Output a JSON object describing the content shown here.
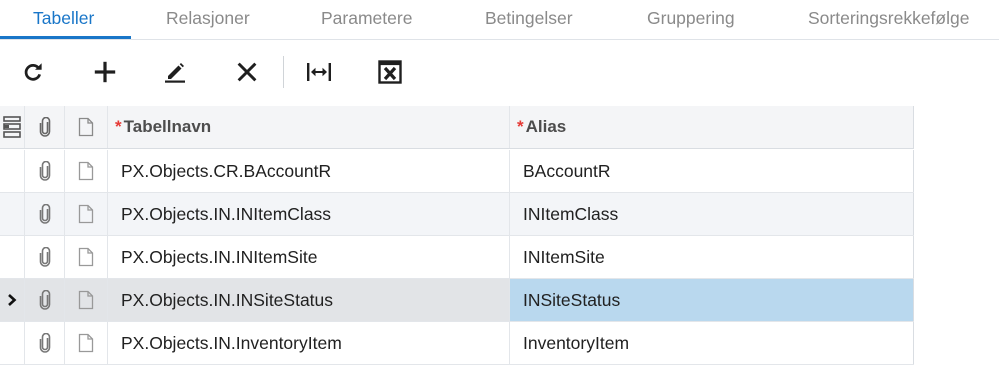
{
  "tabs": [
    {
      "label": "Tabeller",
      "active": true
    },
    {
      "label": "Relasjoner",
      "active": false
    },
    {
      "label": "Parametere",
      "active": false
    },
    {
      "label": "Betingelser",
      "active": false
    },
    {
      "label": "Gruppering",
      "active": false
    },
    {
      "label": "Sorteringsrekkefølge",
      "active": false
    }
  ],
  "toolbar": {
    "buttons": [
      {
        "icon": "refresh-icon"
      },
      {
        "icon": "plus-icon"
      },
      {
        "icon": "pencil-icon"
      },
      {
        "icon": "close-icon"
      },
      {
        "icon": "fit-columns-icon"
      },
      {
        "icon": "excel-export-icon"
      }
    ]
  },
  "grid": {
    "columns": {
      "name": {
        "required_mark": "*",
        "label": "Tabellnavn"
      },
      "alias": {
        "required_mark": "*",
        "label": "Alias"
      }
    },
    "rows": [
      {
        "name": "PX.Objects.CR.BAccountR",
        "alias": "BAccountR",
        "selected": false
      },
      {
        "name": "PX.Objects.IN.INItemClass",
        "alias": "INItemClass",
        "selected": false
      },
      {
        "name": "PX.Objects.IN.INItemSite",
        "alias": "INItemSite",
        "selected": false
      },
      {
        "name": "PX.Objects.IN.INSiteStatus",
        "alias": "INSiteStatus",
        "selected": true
      },
      {
        "name": "PX.Objects.IN.InventoryItem",
        "alias": "InventoryItem",
        "selected": false
      }
    ]
  },
  "colors": {
    "accent": "#1976c8",
    "selected_cell": "#b9d8ee",
    "required": "#e53935"
  }
}
